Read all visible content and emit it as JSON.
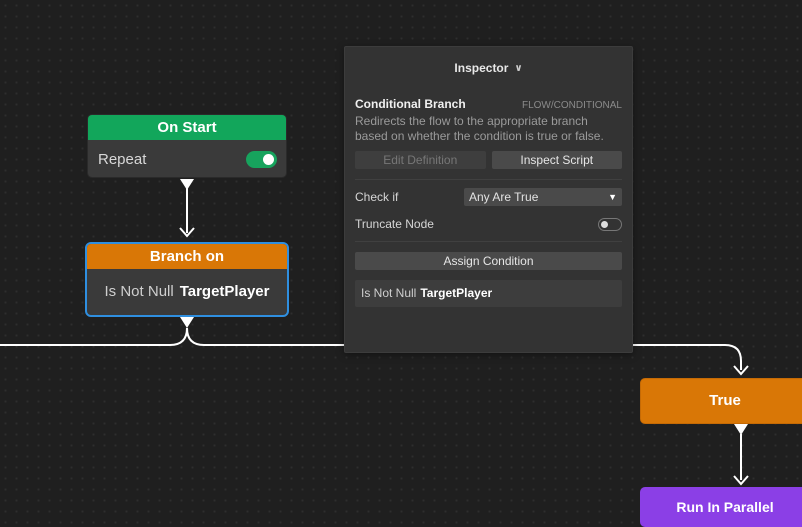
{
  "nodes": {
    "on_start": {
      "title": "On Start",
      "row_label": "Repeat",
      "repeat_enabled": true,
      "color": "#12a65b"
    },
    "branch": {
      "title": "Branch on",
      "condition_prefix": "Is Not Null",
      "condition_target": "TargetPlayer",
      "color": "#d97706",
      "selected_border": "#2f8fe0"
    },
    "true_node": {
      "title": "True",
      "color": "#d97706"
    },
    "parallel": {
      "title": "Run In Parallel",
      "color": "#8b3fe6"
    }
  },
  "inspector": {
    "header": "Inspector",
    "node_title": "Conditional Branch",
    "category": "FLOW/CONDITIONAL",
    "description_line1": "Redirects the flow to the appropriate branch",
    "description_line2": "based on whether the condition is true or false.",
    "edit_definition_label": "Edit Definition",
    "inspect_script_label": "Inspect Script",
    "check_if_label": "Check if",
    "check_if_value": "Any Are True",
    "truncate_label": "Truncate Node",
    "truncate_enabled": false,
    "assign_condition_label": "Assign Condition",
    "condition_prefix": "Is Not Null",
    "condition_target": "TargetPlayer"
  },
  "icons": {
    "toggle": "toggle-switch-icon",
    "dropdown": "chevron-down-icon"
  }
}
